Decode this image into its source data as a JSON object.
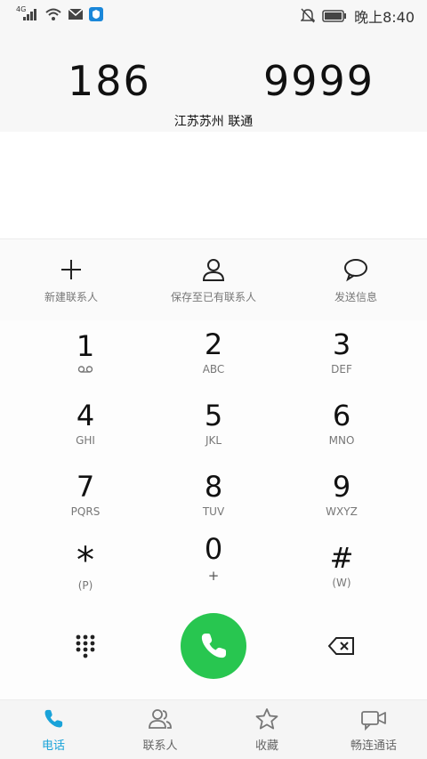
{
  "status_bar": {
    "network": "4G",
    "time": "晚上8:40"
  },
  "dial": {
    "number_part1": "186",
    "number_part2": "9999",
    "location": "江苏苏州 联通"
  },
  "actions": [
    {
      "label": "新建联系人",
      "icon": "plus-icon"
    },
    {
      "label": "保存至已有联系人",
      "icon": "person-icon"
    },
    {
      "label": "发送信息",
      "icon": "message-icon"
    }
  ],
  "keypad": [
    {
      "digit": "1",
      "letters": ""
    },
    {
      "digit": "2",
      "letters": "ABC"
    },
    {
      "digit": "3",
      "letters": "DEF"
    },
    {
      "digit": "4",
      "letters": "GHI"
    },
    {
      "digit": "5",
      "letters": "JKL"
    },
    {
      "digit": "6",
      "letters": "MNO"
    },
    {
      "digit": "7",
      "letters": "PQRS"
    },
    {
      "digit": "8",
      "letters": "TUV"
    },
    {
      "digit": "9",
      "letters": "WXYZ"
    },
    {
      "digit": "*",
      "letters": "(P)"
    },
    {
      "digit": "0",
      "letters": "+"
    },
    {
      "digit": "#",
      "letters": "(W)"
    }
  ],
  "nav": [
    {
      "label": "电话",
      "icon": "phone-icon",
      "active": true
    },
    {
      "label": "联系人",
      "icon": "contacts-icon",
      "active": false
    },
    {
      "label": "收藏",
      "icon": "star-icon",
      "active": false
    },
    {
      "label": "畅连通话",
      "icon": "video-call-icon",
      "active": false
    }
  ],
  "colors": {
    "call_green": "#28c650",
    "active_blue": "#1aa3d9"
  }
}
